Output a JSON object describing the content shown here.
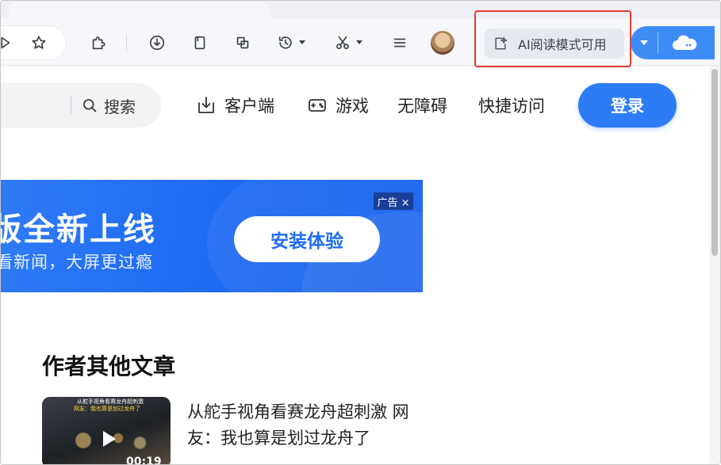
{
  "toolbar": {
    "ai_reading_label": "AI阅读模式可用"
  },
  "header": {
    "search_label": "搜索",
    "nav": [
      {
        "label": "客户端"
      },
      {
        "label": "游戏"
      },
      {
        "label": "无障碍"
      },
      {
        "label": "快捷访问"
      }
    ],
    "login_label": "登录"
  },
  "banner": {
    "title": "版全新上线",
    "subtitle": "看新闻，大屏更过瘾",
    "cta_label": "安装体验",
    "ad_tag": "广告 ×"
  },
  "articles": {
    "section_title": "作者其他文章",
    "items": [
      {
        "thumb_caption_1": "从舵手视角看赛龙舟超刺激",
        "thumb_caption_2": "网友：我也算是划过龙舟了",
        "duration": "00:19",
        "title": "从舵手视角看赛龙舟超刺激 网友：我也算是划过龙舟了"
      }
    ]
  },
  "colors": {
    "accent": "#2d7cf6",
    "highlight_border": "#e23b2e",
    "banner_bg": "#1f6cf3"
  }
}
